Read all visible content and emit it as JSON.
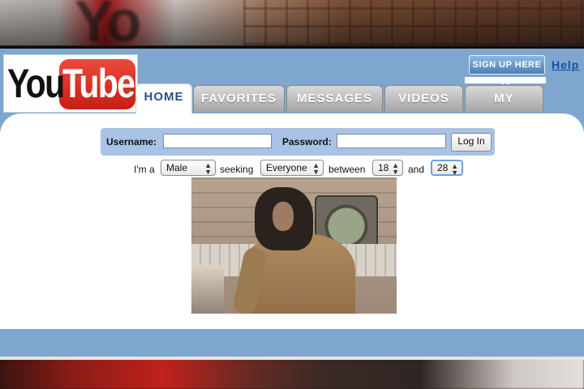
{
  "logo": {
    "you": "You",
    "tube": "Tube"
  },
  "background": {
    "letters": "Yo"
  },
  "header": {
    "signup_label": "SIGN UP HERE >>",
    "help_label": "Help"
  },
  "tabs": [
    {
      "label": "HOME",
      "active": true
    },
    {
      "label": "FAVORITES",
      "active": false
    },
    {
      "label": "MESSAGES",
      "active": false
    },
    {
      "label": "VIDEOS",
      "active": false
    },
    {
      "label": "MY PROFILE",
      "active": false
    }
  ],
  "login": {
    "username_label": "Username:",
    "username_value": "",
    "password_label": "Password:",
    "password_value": "",
    "login_button": "Log In"
  },
  "seek": {
    "im_a": "I'm a",
    "gender": "Male",
    "seeking": "seeking",
    "seeking_value": "Everyone",
    "between": "between",
    "age_min": "18",
    "and": "and",
    "age_max": "28"
  },
  "colors": {
    "page_blue": "#7ea6cf",
    "login_bar": "#a9c3e6",
    "logo_red": "#c81e15",
    "tab_active_text": "#2b4f87",
    "help_link": "#1a4fa0"
  }
}
